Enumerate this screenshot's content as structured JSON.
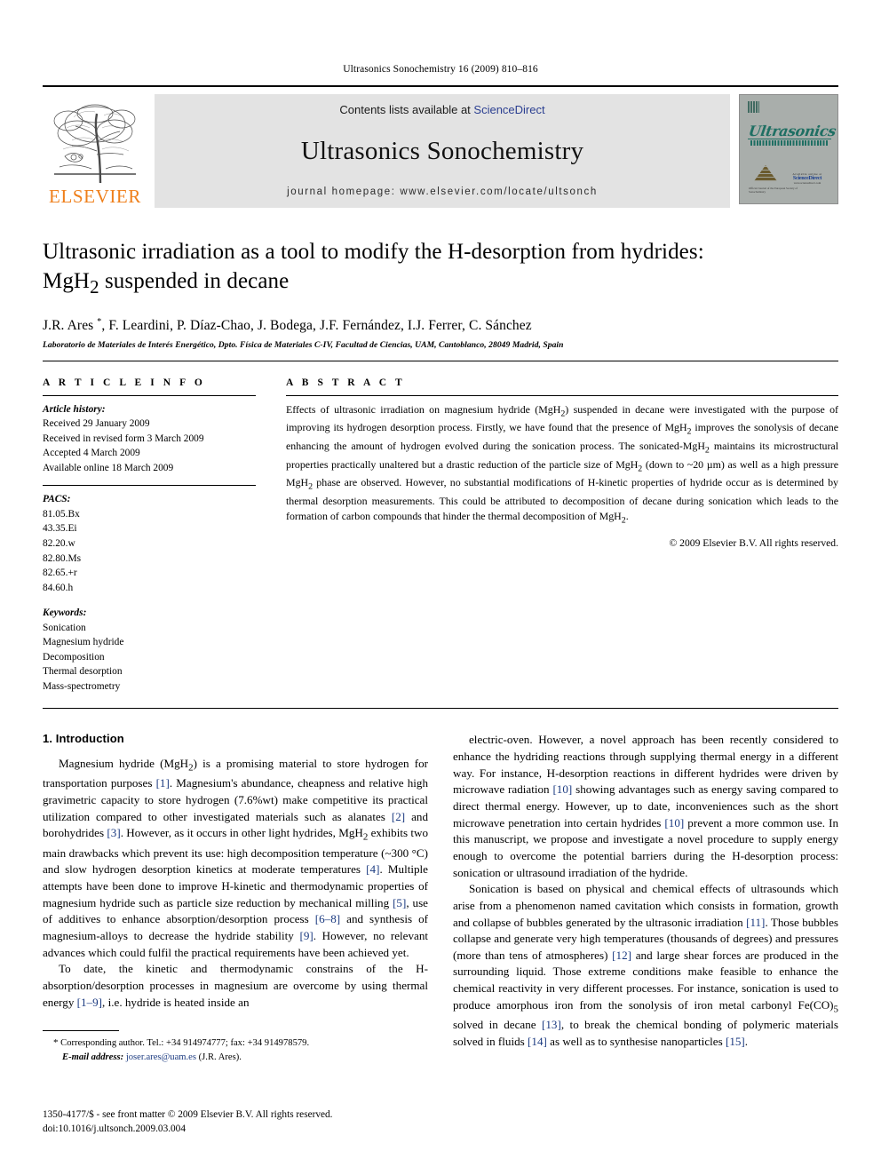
{
  "running_head": "Ultrasonics Sonochemistry 16 (2009) 810–816",
  "masthead": {
    "publisher_logo_text": "ELSEVIER",
    "contents_prefix": "Contents lists available at ",
    "contents_link": "ScienceDirect",
    "journal_title": "Ultrasonics Sonochemistry",
    "homepage_line": "journal homepage: www.elsevier.com/locate/ultsonch",
    "cover": {
      "script_title": "Ultrasonics",
      "subtitle": "SONOCHEMISTRY",
      "sd_label_top": "Available online at",
      "sd_label": "ScienceDirect",
      "sd_label_bottom": "www.sciencedirect.com",
      "footnote": "Official Journal of the European Society of Sonochemistry"
    }
  },
  "article": {
    "title_line1": "Ultrasonic irradiation as a tool to modify the H-desorption from hydrides:",
    "title_line2_pre": "MgH",
    "title_line2_sub": "2",
    "title_line2_post": " suspended in decane",
    "authors": "J.R. Ares *, F. Leardini, P. Díaz-Chao, J. Bodega, J.F. Fernández, I.J. Ferrer, C. Sánchez",
    "affiliation": "Laboratorio de Materiales de Interés Energético, Dpto. Física de Materiales C-IV, Facultad de Ciencias, UAM, Cantoblanco, 28049 Madrid, Spain"
  },
  "article_info": {
    "label": "A R T I C L E   I N F O",
    "history_head": "Article history:",
    "history": [
      "Received 29 January 2009",
      "Received in revised form 3 March 2009",
      "Accepted 4 March 2009",
      "Available online 18 March 2009"
    ],
    "pacs_head": "PACS:",
    "pacs": [
      "81.05.Bx",
      "43.35.Ei",
      "82.20.w",
      "82.80.Ms",
      "82.65.+r",
      "84.60.h"
    ],
    "keywords_head": "Keywords:",
    "keywords": [
      "Sonication",
      "Magnesium hydride",
      "Decomposition",
      "Thermal desorption",
      "Mass-spectrometry"
    ]
  },
  "abstract": {
    "label": "A B S T R A C T",
    "text": "Effects of ultrasonic irradiation on magnesium hydride (MgH2) suspended in decane were investigated with the purpose of improving its hydrogen desorption process. Firstly, we have found that the presence of MgH2 improves the sonolysis of decane enhancing the amount of hydrogen evolved during the sonication process. The sonicated-MgH2 maintains its microstructural properties practically unaltered but a drastic reduction of the particle size of MgH2 (down to ~20 µm) as well as a high pressure MgH2 phase are observed. However, no substantial modifications of H-kinetic properties of hydride occur as is determined by thermal desorption measurements. This could be attributed to decomposition of decane during sonication which leads to the formation of carbon compounds that hinder the thermal decomposition of MgH2.",
    "copyright": "© 2009 Elsevier B.V. All rights reserved."
  },
  "body": {
    "section_title": "1. Introduction",
    "left_paragraphs": [
      "Magnesium hydride (MgH2) is a promising material to store hydrogen for transportation purposes [1]. Magnesium's abundance, cheapness and relative high gravimetric capacity to store hydrogen (7.6%wt) make competitive its practical utilization compared to other investigated materials such as alanates [2] and borohydrides [3]. However, as it occurs in other light hydrides, MgH2 exhibits two main drawbacks which prevent its use: high decomposition temperature (~300 °C) and slow hydrogen desorption kinetics at moderate temperatures [4]. Multiple attempts have been done to improve H-kinetic and thermodynamic properties of magnesium hydride such as particle size reduction by mechanical milling [5], use of additives to enhance absorption/desorption process [6–8] and synthesis of magnesium-alloys to decrease the hydride stability [9]. However, no relevant advances which could fulfil the practical requirements have been achieved yet.",
      "To date, the kinetic and thermodynamic constrains of the H-absorption/desorption processes in magnesium are overcome by using thermal energy [1–9], i.e. hydride is heated inside an"
    ],
    "right_paragraphs": [
      "electric-oven. However, a novel approach has been recently considered to enhance the hydriding reactions through supplying thermal energy in a different way. For instance, H-desorption reactions in different hydrides were driven by microwave radiation [10] showing advantages such as energy saving compared to direct thermal energy. However, up to date, inconveniences such as the short microwave penetration into certain hydrides [10] prevent a more common use. In this manuscript, we propose and investigate a novel procedure to supply energy enough to overcome the potential barriers during the H-desorption process: sonication or ultrasound irradiation of the hydride.",
      "Sonication is based on physical and chemical effects of ultrasounds which arise from a phenomenon named cavitation which consists in formation, growth and collapse of bubbles generated by the ultrasonic irradiation [11]. Those bubbles collapse and generate very high temperatures (thousands of degrees) and pressures (more than tens of atmospheres) [12] and large shear forces are produced in the surrounding liquid. Those extreme conditions make feasible to enhance the chemical reactivity in very different processes. For instance, sonication is used to produce amorphous iron from the sonolysis of iron metal carbonyl Fe(CO)5 solved in decane [13], to break the chemical bonding of polymeric materials solved in fluids [14] as well as to synthesise nanoparticles [15]."
    ]
  },
  "footnote": {
    "marker": "*",
    "corresponding": "Corresponding author. Tel.: +34 914974777; fax: +34 914978579.",
    "email_label": "E-mail address:",
    "email": "joser.ares@uam.es",
    "email_owner": "(J.R. Ares)."
  },
  "imprint": {
    "line1": "1350-4177/$ - see front matter © 2009 Elsevier B.V. All rights reserved.",
    "line2": "doi:10.1016/j.ultsonch.2009.03.004"
  },
  "colors": {
    "link": "#1b3a80",
    "sciencedirect": "#2b3f91",
    "elsevier_orange": "#ef7f1a",
    "band_gray": "#e3e3e3",
    "cover_gray": "#a9aeab",
    "cover_teal": "#1f6f63"
  }
}
